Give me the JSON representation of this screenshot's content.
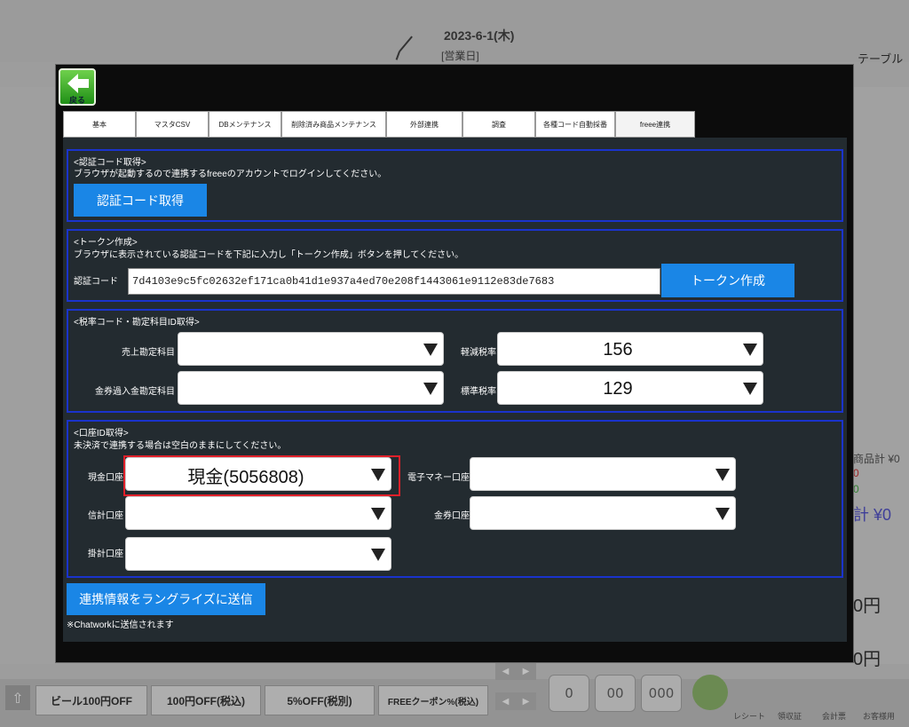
{
  "background": {
    "date": "2023-6-1(木)",
    "business_day": "[営業日]",
    "table_label": "テーブル",
    "right_labels": [
      "商品計 ¥0",
      "0",
      "0",
      "計 ¥0",
      "0円",
      "0円"
    ],
    "bottom_buttons": [
      "ビール100円OFF",
      "100円OFF(税込)",
      "5%OFF(税別)",
      "FREEクーポン%(税込)"
    ],
    "numpad": [
      "0",
      "00",
      "000"
    ],
    "bottom_icons": [
      "レシート",
      "領収証",
      "会計票",
      "お客様用"
    ]
  },
  "modal": {
    "back_label": "戻る",
    "tabs": [
      {
        "label": "基本",
        "width": 82
      },
      {
        "label": "マスタCSV",
        "width": 82
      },
      {
        "label": "DBメンテナンス",
        "width": 82
      },
      {
        "label": "削除済み商品メンテナンス",
        "width": 118
      },
      {
        "label": "外部連携",
        "width": 86
      },
      {
        "label": "調査",
        "width": 82
      },
      {
        "label": "各種コード自動採番",
        "width": 90
      },
      {
        "label": "freee連携",
        "width": 90
      }
    ],
    "auth": {
      "title": "<認証コード取得>",
      "desc": "ブラウザが起動するので連携するfreeeのアカウントでログインしてください。",
      "button": "認証コード取得"
    },
    "token": {
      "title": "<トークン作成>",
      "desc": "ブラウザに表示されている認証コードを下記に入力し「トークン作成」ボタンを押してください。",
      "label": "認証コード",
      "value": "7d4103e9c5fc02632ef171ca0b41d1e937a4ed70e208f1443061e9112e83de7683",
      "button": "トークン作成"
    },
    "tax": {
      "title": "<税率コード・勘定科目ID取得>",
      "sales_label": "売上勘定科目",
      "sales_value": "",
      "voucher_label": "金券過入金勘定科目",
      "voucher_value": "",
      "reduced_label": "軽減税率",
      "reduced_value": "156",
      "standard_label": "標準税率",
      "standard_value": "129"
    },
    "account": {
      "title": "<口座ID取得>",
      "desc": "未決済で連携する場合は空白のままにしてください。",
      "cash_label": "現金口座",
      "cash_value": "現金(5056808)",
      "emoney_label": "電子マネー口座",
      "emoney_value": "",
      "credit_label": "信計口座",
      "credit_value": "",
      "voucher_label": "金券口座",
      "voucher_value": "",
      "kake_label": "掛計口座",
      "kake_value": ""
    },
    "send_button": "連携情報をラングライズに送信",
    "note": "※Chatworkに送信されます"
  }
}
